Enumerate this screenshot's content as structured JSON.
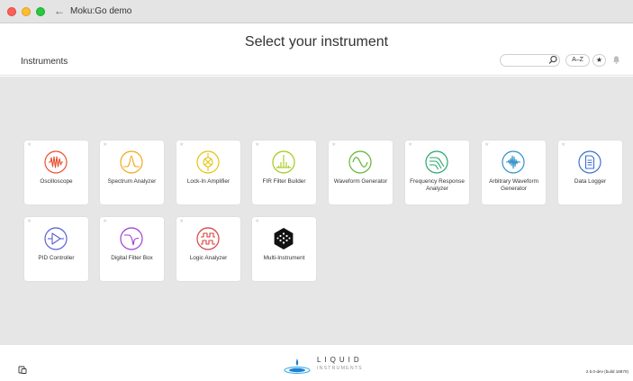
{
  "window": {
    "title": "Moku:Go demo",
    "back_glyph": "←"
  },
  "header": {
    "page_title": "Select your instrument",
    "section_label": "Instruments",
    "search": {
      "value": "",
      "placeholder": ""
    },
    "sort_button": "A–Z",
    "favorites_glyph": "★"
  },
  "instruments": [
    {
      "label": "Oscilloscope",
      "icon": "oscilloscope-icon",
      "color": "#e8502f"
    },
    {
      "label": "Spectrum Analyzer",
      "icon": "spectrum-analyzer-icon",
      "color": "#f0a81a"
    },
    {
      "label": "Lock-In Amplifier",
      "icon": "lock-in-amplifier-icon",
      "color": "#e8c20e"
    },
    {
      "label": "FIR Filter Builder",
      "icon": "fir-filter-builder-icon",
      "color": "#a2c91b"
    },
    {
      "label": "Waveform Generator",
      "icon": "waveform-generator-icon",
      "color": "#5fb431"
    },
    {
      "label": "Frequency Response Analyzer",
      "icon": "frequency-response-analyzer-icon",
      "color": "#27a66c"
    },
    {
      "label": "Arbitrary Waveform Generator",
      "icon": "arbitrary-waveform-generator-icon",
      "color": "#2f8fcb"
    },
    {
      "label": "Data Logger",
      "icon": "data-logger-icon",
      "color": "#3a6fd0"
    },
    {
      "label": "PID Controller",
      "icon": "pid-controller-icon",
      "color": "#5b5fd6"
    },
    {
      "label": "Digital Filter Box",
      "icon": "digital-filter-box-icon",
      "color": "#9d3fd3"
    },
    {
      "label": "Logic Analyzer",
      "icon": "logic-analyzer-icon",
      "color": "#d43f3f"
    },
    {
      "label": "Multi-Instrument",
      "icon": "multi-instrument-icon",
      "color": "#111111"
    }
  ],
  "footer": {
    "logo_line1": "LIQUID",
    "logo_line2": "INSTRUMENTS",
    "version": "2.5.0-dev (build 16870)",
    "logo_colors": [
      "#1f7fd1",
      "#48b6e8"
    ]
  }
}
